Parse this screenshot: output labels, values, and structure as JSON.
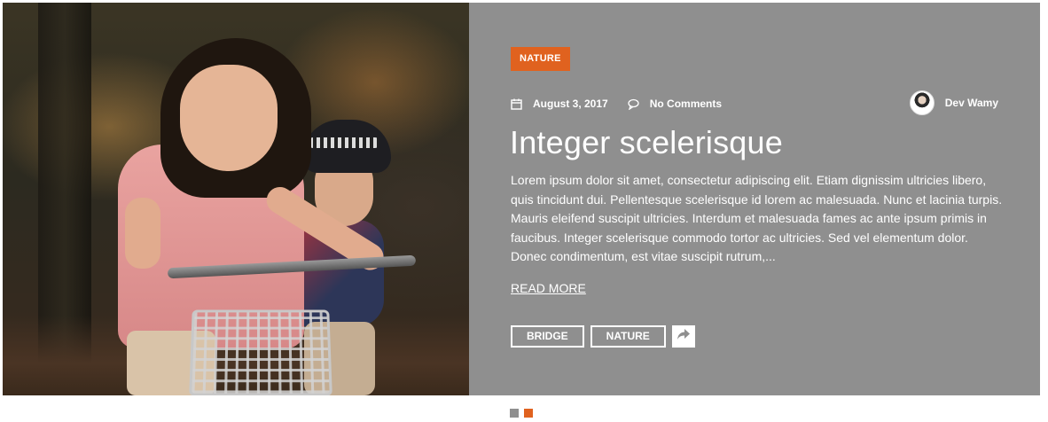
{
  "post": {
    "category": "NATURE",
    "date": "August 3, 2017",
    "comments": "No Comments",
    "author": "Dev Wamy",
    "title": "Integer scelerisque",
    "excerpt": "Lorem ipsum dolor sit amet, consectetur adipiscing elit. Etiam dignissim ultricies libero, quis tincidunt dui. Pellentesque scelerisque id lorem ac malesuada. Nunc et lacinia turpis. Mauris eleifend suscipit ultricies. Interdum et malesuada fames ac ante ipsum primis in faucibus. Integer scelerisque commodo tortor ac ultricies. Sed vel elementum dolor. Donec condimentum, est vitae suscipit rutrum,...",
    "read_more": "READ MORE",
    "tags": [
      "BRIDGE",
      "NATURE"
    ],
    "icons": {
      "date": "calendar-icon",
      "comments": "comment-icon",
      "share": "share-icon"
    }
  },
  "pager": {
    "count": 2,
    "active_index": 1
  },
  "colors": {
    "panel_bg": "#8f8f8f",
    "accent": "#e0621f",
    "dot_inactive": "#8f8f8f",
    "text": "#ffffff"
  }
}
